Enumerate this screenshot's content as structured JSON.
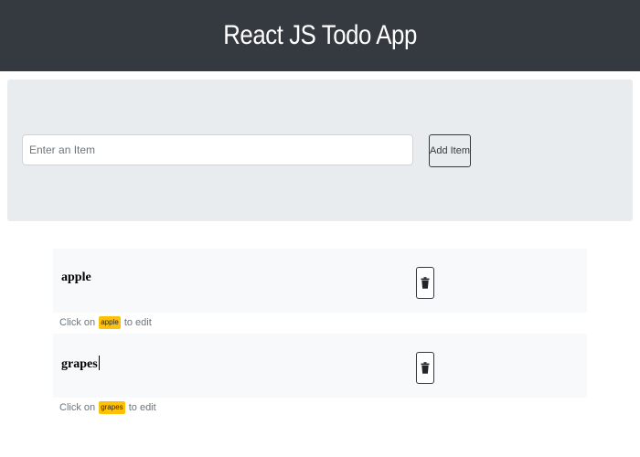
{
  "header": {
    "title": "React JS Todo App"
  },
  "input_panel": {
    "input_placeholder": "Enter an Item",
    "input_value": "",
    "add_button_label": "Add Item"
  },
  "todos": [
    {
      "text": "apple",
      "hint_prefix": "Click on",
      "hint_tag": "apple",
      "hint_suffix": "to edit",
      "delete_icon": "trash-icon"
    },
    {
      "text": "grapes",
      "hint_prefix": "Click on",
      "hint_tag": "grapes",
      "hint_suffix": "to edit",
      "delete_icon": "trash-icon"
    }
  ],
  "colors": {
    "header_bg": "#343a40",
    "panel_bg": "#e9ecef",
    "row_bg": "#f8f9fa",
    "tag_bg": "#ffc107"
  }
}
